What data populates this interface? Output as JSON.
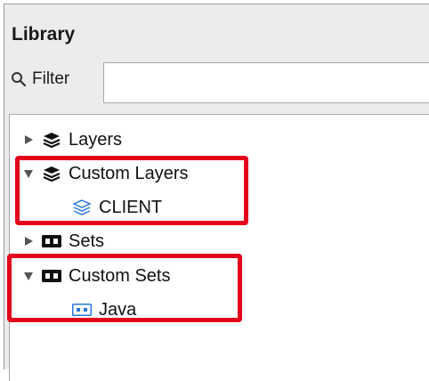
{
  "library": {
    "title": "Library",
    "filter_label": "Filter",
    "filter_value": "",
    "filter_icon": "search-icon"
  },
  "tree": {
    "items": [
      {
        "label": "Layers",
        "expanded": false,
        "icon": "layers-icon",
        "level": 0
      },
      {
        "label": "Custom Layers",
        "expanded": true,
        "icon": "layers-icon",
        "level": 0
      },
      {
        "label": "CLIENT",
        "icon": "layer-outline-icon",
        "level": 1
      },
      {
        "label": "Sets",
        "expanded": false,
        "icon": "set-icon",
        "level": 0
      },
      {
        "label": "Custom Sets",
        "expanded": true,
        "icon": "set-icon",
        "level": 0
      },
      {
        "label": "Java",
        "icon": "set-blue-icon",
        "level": 1
      }
    ]
  },
  "highlight_color": "#e3001b",
  "blue_icon_color": "#2a78d6"
}
